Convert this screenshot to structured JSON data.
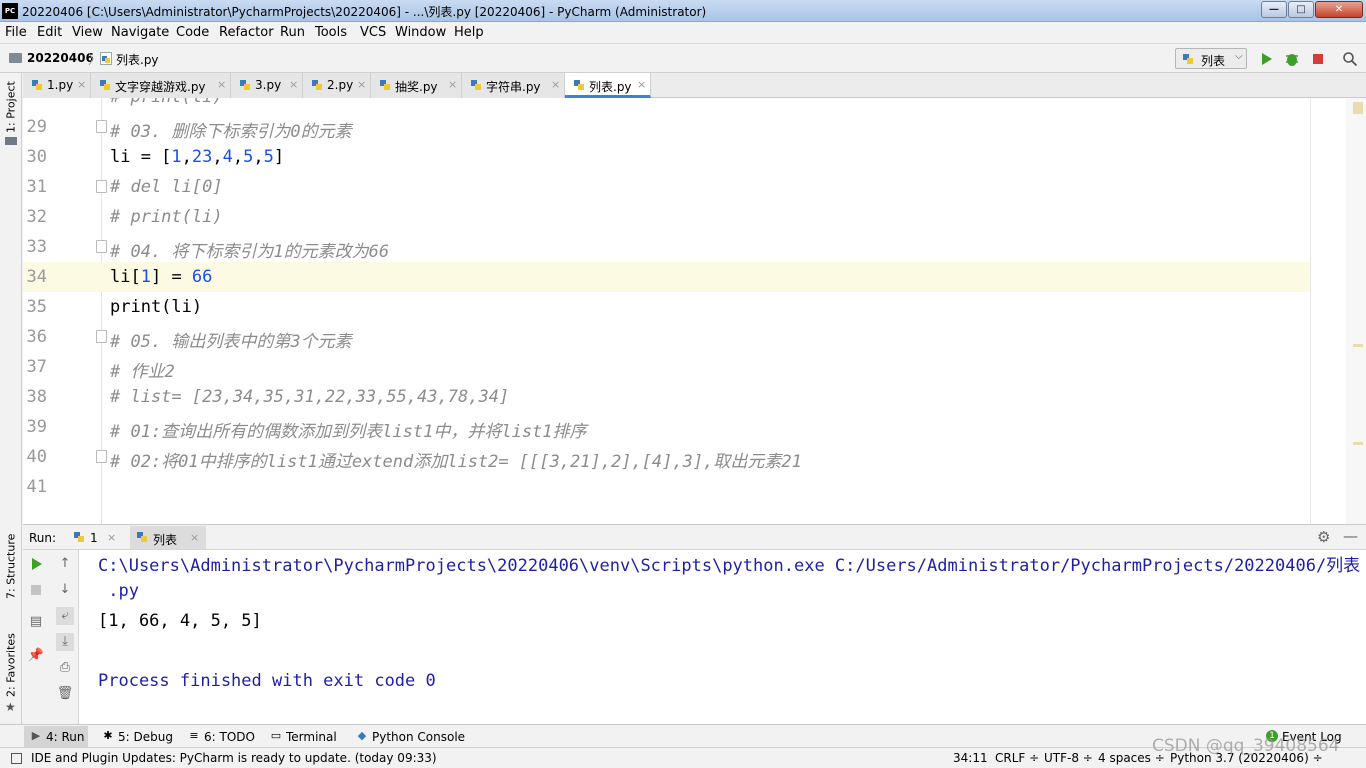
{
  "window": {
    "title": "20220406 [C:\\Users\\Administrator\\PycharmProjects\\20220406] - ...\\列表.py [20220406] - PyCharm (Administrator)",
    "logo_text": "PC",
    "min_label": "—",
    "max_label": "□",
    "close_label": "✕"
  },
  "menu": [
    "File",
    "Edit",
    "View",
    "Navigate",
    "Code",
    "Refactor",
    "Run",
    "Tools",
    "VCS",
    "Window",
    "Help"
  ],
  "breadcrumb": {
    "project": "20220406",
    "separator": "〉",
    "file": "列表.py"
  },
  "run_config": {
    "label": "列表",
    "arrow": "⌵"
  },
  "left_strip": {
    "project": "1: Project",
    "structure": "7: Structure",
    "favorites": "2: Favorites"
  },
  "editor_tabs": [
    {
      "label": "1.py",
      "close": "×"
    },
    {
      "label": "文字穿越游戏.py",
      "close": "×"
    },
    {
      "label": "3.py",
      "close": "×"
    },
    {
      "label": "2.py",
      "close": "×"
    },
    {
      "label": "抽奖.py",
      "close": "×"
    },
    {
      "label": "字符串.py",
      "close": "×"
    },
    {
      "label": "列表.py",
      "close": "×"
    }
  ],
  "editor": {
    "top_partial": "# print(li)",
    "lines": [
      {
        "num": "29",
        "code": "# 03. 删除下标索引为0的元素"
      },
      {
        "num": "30",
        "code_parts": [
          "li = [",
          "1",
          ",",
          "23",
          ",",
          "4",
          ",",
          "5",
          ",",
          "5",
          "]"
        ]
      },
      {
        "num": "31",
        "code": "# del li[0]"
      },
      {
        "num": "32",
        "code": "# print(li)"
      },
      {
        "num": "33",
        "code": "# 04. 将下标索引为1的元素改为66"
      },
      {
        "num": "34",
        "code_parts": [
          "li[",
          "1",
          "] = ",
          "66"
        ]
      },
      {
        "num": "35",
        "code": "print(li)"
      },
      {
        "num": "36",
        "code": "# 05. 输出列表中的第3个元素"
      },
      {
        "num": "37",
        "code": "# 作业2"
      },
      {
        "num": "38",
        "code": "# list= [23,34,35,31,22,33,55,43,78,34]"
      },
      {
        "num": "39",
        "code": "# 01:查询出所有的偶数添加到列表list1中，并将list1排序"
      },
      {
        "num": "40",
        "code": "# 02:将01中排序的list1通过extend添加list2= [[[3,21],2],[4],3],取出元素21"
      },
      {
        "num": "41",
        "code": ""
      }
    ]
  },
  "run_panel": {
    "title": "Run:",
    "tabs": [
      {
        "label": "1",
        "close": "×"
      },
      {
        "label": "列表",
        "close": "×"
      }
    ],
    "console": [
      "C:\\Users\\Administrator\\PycharmProjects\\20220406\\venv\\Scripts\\python.exe C:/Users/Administrator/PycharmProjects/20220406/列表",
      " .py",
      "[1, 66, 4, 5, 5]",
      "",
      "Process finished with exit code 0"
    ]
  },
  "bottom_tabs": [
    {
      "label": "4: Run",
      "icon": "▶"
    },
    {
      "label": "5: Debug",
      "icon": "✱"
    },
    {
      "label": "6: TODO",
      "icon": "≡"
    },
    {
      "label": "Terminal",
      "icon": "▭"
    },
    {
      "label": "Python Console",
      "icon": "◆"
    }
  ],
  "event_log": "Event Log",
  "status": {
    "message": "IDE and Plugin Updates: PyCharm is ready to update. (today 09:33)",
    "position": "34:11",
    "line_sep": "CRLF ÷",
    "encoding": "UTF-8 ÷",
    "indent": "4 spaces ÷",
    "interpreter": "Python 3.7 (20220406) ÷"
  },
  "watermark": "CSDN @qq_39408564",
  "colors": {
    "comment": "#8c8c8c",
    "number": "#1750eb",
    "console_text": "#1f1fa6",
    "caret_row": "#fdfae4",
    "run_green": "#3e9e2a",
    "stop_red": "#d83b3b"
  }
}
